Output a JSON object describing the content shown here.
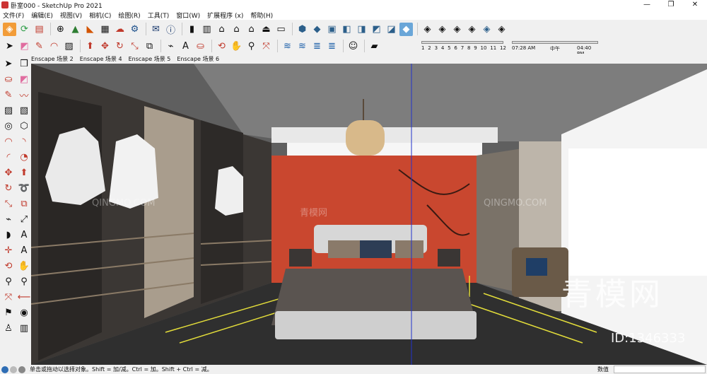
{
  "window": {
    "title": "卧室000 - SketchUp Pro 2021",
    "controls": [
      "—",
      "❐",
      "✕"
    ]
  },
  "menu": [
    "文件(F)",
    "编辑(E)",
    "视图(V)",
    "相机(C)",
    "绘图(R)",
    "工具(T)",
    "窗口(W)",
    "扩展程序 (x)",
    "帮助(H)"
  ],
  "scenes": [
    "Enscape 场景 2",
    "Enscape 场景 4",
    "Enscape 场景 5",
    "Enscape 场景 6"
  ],
  "shadow": {
    "months": [
      "1",
      "2",
      "3",
      "4",
      "5",
      "6",
      "7",
      "8",
      "9",
      "10",
      "11",
      "12"
    ],
    "time_start": "07:28 AM",
    "time_mid": "中午",
    "time_end": "04:40 PM"
  },
  "status": {
    "hint": "单击或拖动以选择对象。Shift = 加/减。Ctrl = 加。Shift + Ctrl = 减。",
    "measure_label": "数值",
    "measure_value": ""
  },
  "watermark": {
    "brand": "青模网",
    "id": "ID:1346333",
    "small": "青模网",
    "small_en": "QINGMO.COM"
  },
  "colors": {
    "accent_wall": "#c9472f",
    "ceiling": "#7a7a7a",
    "floor": "#2f2f2f",
    "floor_lines": "#e3dd3a",
    "closet": "#3a3634"
  },
  "icons": {
    "toolbar1": [
      "getting-started-icon",
      "warehouse-icon",
      "extension-warehouse-icon",
      "add-location-icon",
      "sandbox-icon",
      "terrain-icon",
      "checker-icon",
      "upload-icon",
      "download-icon",
      "settings-icon",
      "email-icon",
      "info-icon",
      "component-icon",
      "section-icon",
      "house-icon",
      "house-outline-icon",
      "house-window-icon",
      "house-roof-icon",
      "house-base-icon",
      "iso-view-icon",
      "top-view-icon",
      "front-view-icon",
      "right-view-icon",
      "back-view-icon",
      "left-view-icon",
      "bottom-view-icon",
      "xray-icon",
      "back-edges-icon",
      "wireframe-icon",
      "hidden-line-icon",
      "shaded-icon",
      "shaded-texture-icon",
      "monochrome-icon"
    ],
    "toolbar2": [
      "select-icon",
      "eraser-icon",
      "pencil-icon",
      "arc-icon",
      "rectangle-icon",
      "push-pull-icon",
      "move-icon",
      "rotate-icon",
      "scale-icon",
      "offset-icon",
      "tape-icon",
      "text-icon",
      "paint-icon",
      "orbit-icon",
      "pan-icon",
      "zoom-icon",
      "zoom-extents-icon",
      "layers-icon",
      "layers2-icon",
      "stack-icon",
      "user-icon",
      "shadow-icon"
    ]
  }
}
